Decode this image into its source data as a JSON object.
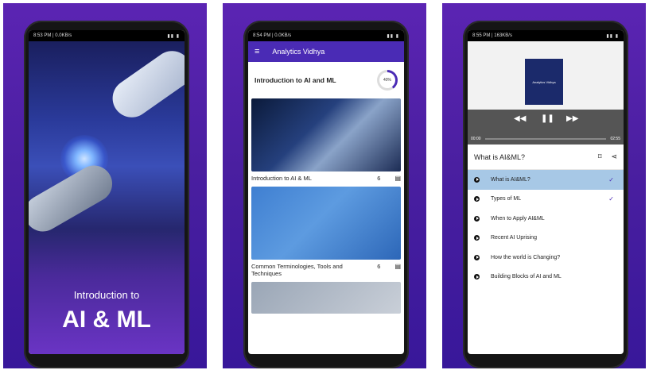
{
  "panels": [
    {
      "status": {
        "time": "8:53 PM",
        "speed": "0.0KB/s"
      },
      "splash": {
        "line1": "Introduction to",
        "line2": "AI & ML"
      }
    },
    {
      "status": {
        "time": "8:54 PM",
        "speed": "0.0KB/s"
      },
      "appbar": {
        "title": "Analytics Vidhya"
      },
      "course": {
        "title": "Introduction to AI and ML",
        "progress_label": "40%"
      },
      "cards": [
        {
          "title": "Introduction to AI & ML",
          "count": "6"
        },
        {
          "title": "Common Terminologies, Tools and Techniques",
          "count": "6"
        }
      ]
    },
    {
      "status": {
        "time": "8:55 PM",
        "speed": "163KB/s"
      },
      "player": {
        "elapsed": "00:00",
        "total": "02:55",
        "thumb_text": "Analytics Vidhya"
      },
      "topic": {
        "title": "What is AI&ML?"
      },
      "lessons": [
        {
          "label": "What is AI&ML?",
          "checked": true
        },
        {
          "label": "Types of ML",
          "checked": true
        },
        {
          "label": "When to Apply AI&ML",
          "checked": false
        },
        {
          "label": "Recent AI Uprising",
          "checked": false
        },
        {
          "label": "How the world is Changing?",
          "checked": false
        },
        {
          "label": "Building Blocks of AI and ML",
          "checked": false
        }
      ]
    }
  ],
  "colors": {
    "purple_bg": "#4a1fa0",
    "app_primary": "#4a2bb5",
    "active_row": "#a7c8e6"
  }
}
